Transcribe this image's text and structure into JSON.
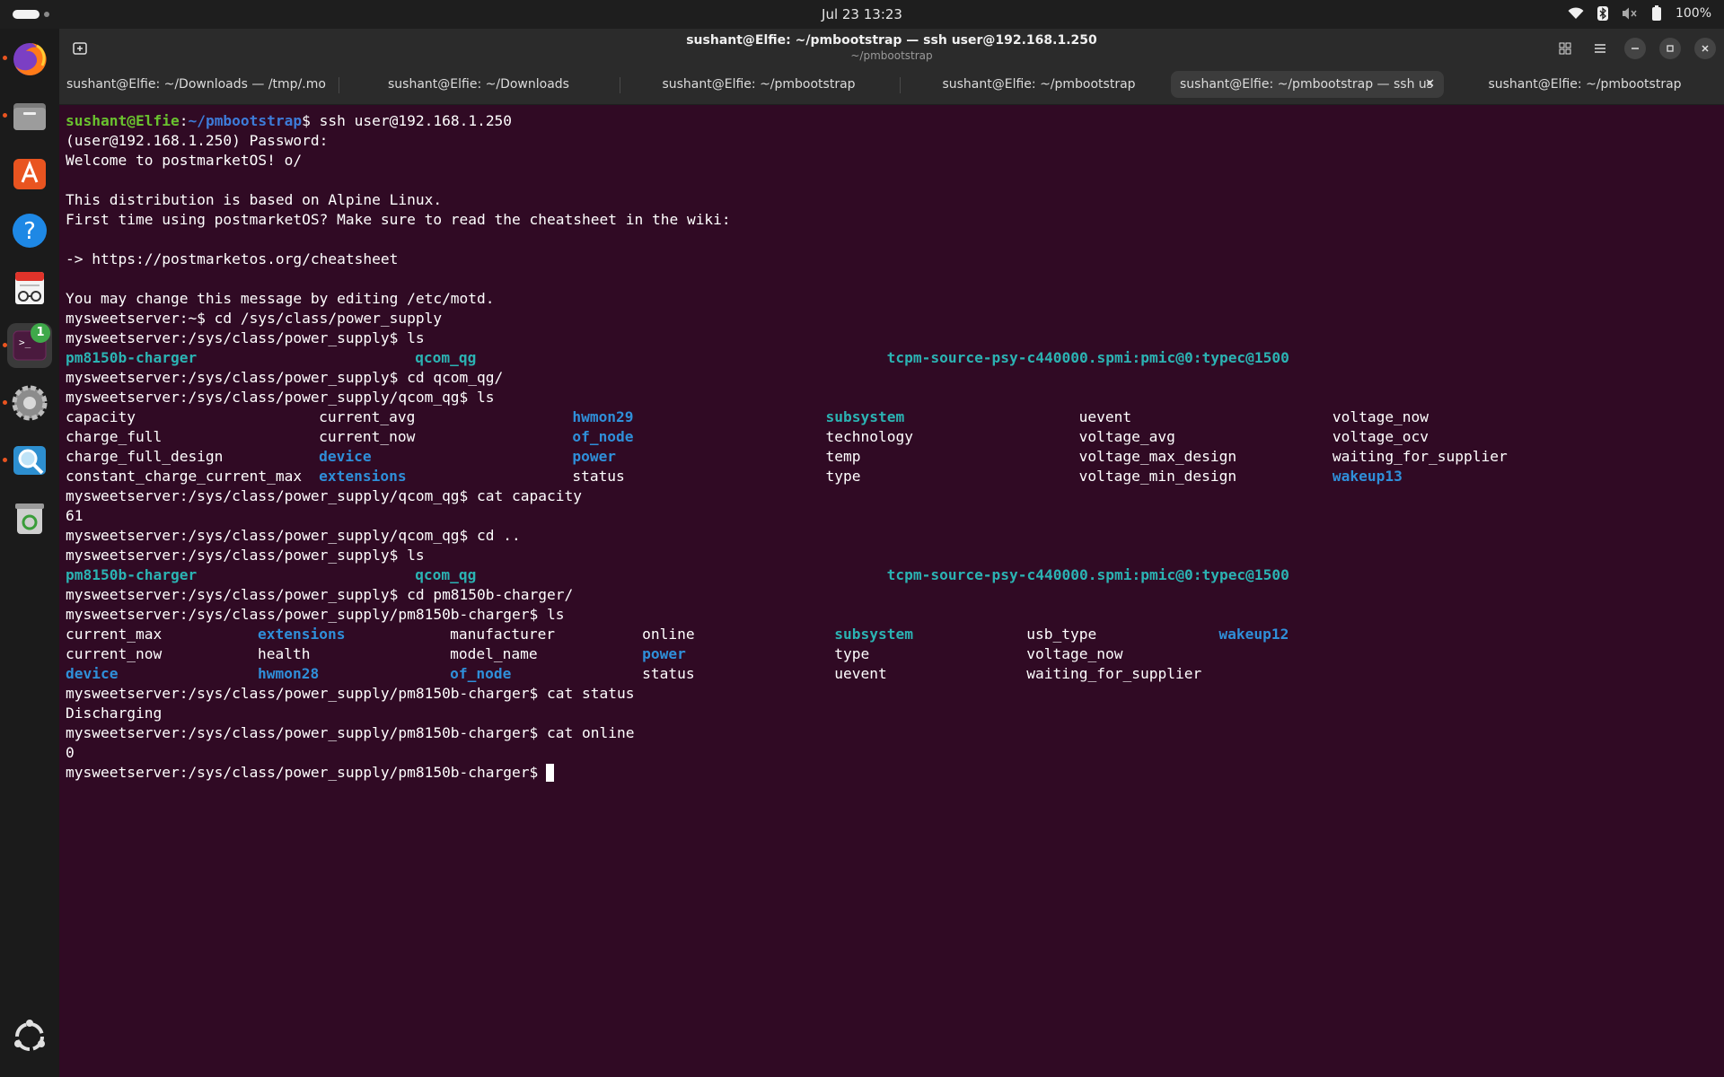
{
  "topbar": {
    "clock": "Jul 23  13:23",
    "battery": "100%",
    "icons": [
      "wifi-icon",
      "bluetooth-icon",
      "volume-muted-icon",
      "battery-icon"
    ]
  },
  "dock": {
    "items": [
      "firefox-icon",
      "files-icon",
      "app-center-icon",
      "help-icon",
      "document-viewer-icon",
      "terminal-icon",
      "settings-icon",
      "image-viewer-icon",
      "trash-icon",
      "ubuntu-icon"
    ],
    "terminal_badge": "1"
  },
  "window": {
    "title": "sushant@Elfie: ~/pmbootstrap — ssh user@192.168.1.250",
    "subtitle": "~/pmbootstrap",
    "tabs": [
      {
        "label": "sushant@Elfie: ~/Downloads — /tmp/.mour",
        "active": false
      },
      {
        "label": "sushant@Elfie: ~/Downloads",
        "active": false
      },
      {
        "label": "sushant@Elfie: ~/pmbootstrap",
        "active": false
      },
      {
        "label": "sushant@Elfie: ~/pmbootstrap",
        "active": false
      },
      {
        "label": "sushant@Elfie: ~/pmbootstrap — ssh us",
        "active": true
      },
      {
        "label": "sushant@Elfie: ~/pmbootstrap",
        "active": false
      }
    ],
    "tab_close": "✕"
  },
  "terminal": {
    "user_host": "sushant@Elfie",
    "path": "~/pmbootstrap",
    "lines": [
      "$ ssh user@192.168.1.250",
      "(user@192.168.1.250) Password:",
      "Welcome to postmarketOS! o/",
      "",
      "This distribution is based on Alpine Linux.",
      "First time using postmarketOS? Make sure to read the cheatsheet in the wiki:",
      "",
      "-> https://postmarketos.org/cheatsheet",
      "",
      "You may change this message by editing /etc/motd.",
      "mysweetserver:~$ cd /sys/class/power_supply",
      "mysweetserver:/sys/class/power_supply$ ls",
      "",
      "mysweetserver:/sys/class/power_supply$ cd qcom_qg/",
      "mysweetserver:/sys/class/power_supply/qcom_qg$ ls",
      "",
      "",
      "",
      "",
      "mysweetserver:/sys/class/power_supply/qcom_qg$ cat capacity",
      "61",
      "mysweetserver:/sys/class/power_supply/qcom_qg$ cd ..",
      "mysweetserver:/sys/class/power_supply$ ls",
      "",
      "mysweetserver:/sys/class/power_supply$ cd pm8150b-charger/",
      "mysweetserver:/sys/class/power_supply/pm8150b-charger$ ls",
      "",
      "",
      "",
      "mysweetserver:/sys/class/power_supply/pm8150b-charger$ cat status",
      "Discharging",
      "mysweetserver:/sys/class/power_supply/pm8150b-charger$ cat online",
      "0",
      "mysweetserver:/sys/class/power_supply/pm8150b-charger$ "
    ],
    "ls_power_supply": [
      "pm8150b-charger",
      "qcom_qg",
      "tcpm-source-psy-c440000.spmi:pmic@0:typec@1500"
    ],
    "ls_qcom_qg": [
      [
        "capacity",
        "current_avg",
        "hwmon29",
        "subsystem",
        "uevent",
        "voltage_now"
      ],
      [
        "charge_full",
        "current_now",
        "of_node",
        "technology",
        "voltage_avg",
        "voltage_ocv"
      ],
      [
        "charge_full_design",
        "device",
        "power",
        "temp",
        "voltage_max_design",
        "waiting_for_supplier"
      ],
      [
        "constant_charge_current_max",
        "extensions",
        "status",
        "type",
        "voltage_min_design",
        "wakeup13"
      ]
    ],
    "ls_charger": [
      [
        "current_max",
        "extensions",
        "manufacturer",
        "online",
        "subsystem",
        "usb_type",
        "wakeup12"
      ],
      [
        "current_now",
        "health",
        "model_name",
        "power",
        "type",
        "voltage_now",
        ""
      ],
      [
        "device",
        "hwmon28",
        "of_node",
        "status",
        "uevent",
        "waiting_for_supplier",
        ""
      ]
    ]
  }
}
